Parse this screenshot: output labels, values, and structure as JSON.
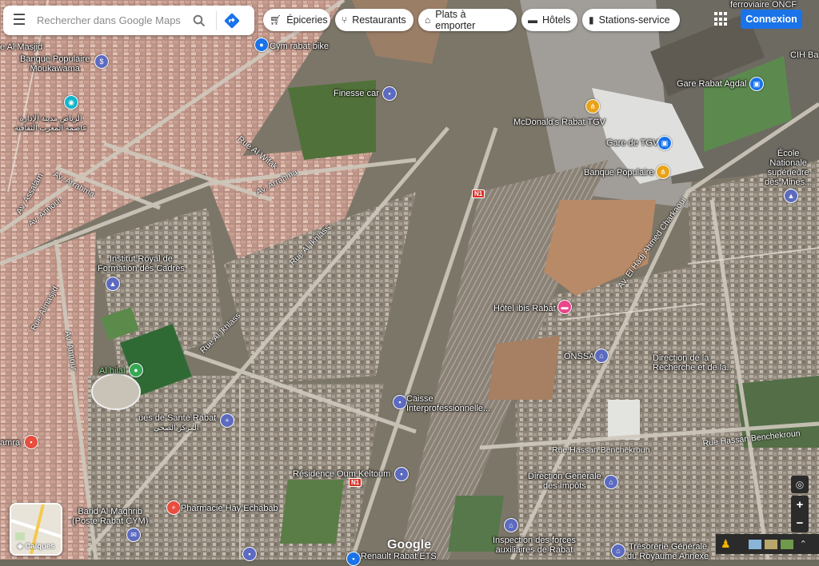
{
  "search": {
    "placeholder": "Rechercher dans Google Maps"
  },
  "chips": [
    {
      "label": "Épiceries",
      "icon": "cart-icon"
    },
    {
      "label": "Restaurants",
      "icon": "fork-knife-icon"
    },
    {
      "label": "Plats à emporter",
      "icon": "takeout-icon"
    },
    {
      "label": "Hôtels",
      "icon": "bed-icon"
    },
    {
      "label": "Stations-service",
      "icon": "fuel-icon"
    }
  ],
  "login": "Connexion",
  "layers": "Calques",
  "brand": "Google",
  "zoom": {
    "in": "+",
    "out": "−"
  },
  "places": {
    "al_masjid": "e Al Masjid",
    "banque_pop_moukawama": "Banque Populaire\nMoukawama",
    "cym": "Cym rabat bike",
    "finesse": "Finesse car",
    "arabic1": "الرياض مدينة الإدارة\nعاصمة المغرب الثقافية",
    "mcdo": "McDonald's Rabat TGV",
    "gare_tgv": "Gare de TGV",
    "banque_pop": "Banque Populaire",
    "gare_agdal": "Gare Rabat Agdal",
    "oncf": "ferroviaire ONCF",
    "cih": "CIH Ba",
    "ecole": "École\nNationale\nsupérieure\ndes Mines...",
    "institut": "Institut Royal de\nFormation des Cadres",
    "al_hilal": "Al hilal",
    "ibis": "Hôtel ibis Rabat",
    "onssa": "ONSSA",
    "direction_rech": "Direction de la\nRecherche et de la...",
    "caisse": "Caisse\nInterprofessionnelle...",
    "sante": "ues de Santé Rabat",
    "sante_ar": "المركز الصحي",
    "amra": "amra",
    "residence": "Résidence Oum Keltoum",
    "direction_impots": "Direction Générale\ndes Impôts",
    "barid": "Barid Al Maghrib\n(Poste Rabat CYM)",
    "pharmacie": "Pharmacie Hay Echabab",
    "inspection": "Inspection des forces\nauxiliaires de Rabat",
    "tresorerie": "Trésorerie Générale\ndu Royaume Annexe",
    "renault": "Renault Rabat ETS"
  },
  "roads": {
    "al_wifak": "Rue Al Wifak",
    "arrahma1": "Av. Arrahma",
    "arrahma2": "Av. Arrahma",
    "assalam": "Av. Assalam",
    "annour1": "Av. Annour",
    "annour2": "Av. Annour",
    "almasjid": "Rue Almasjid",
    "al_ikhlass1": "Rue Al Ikhlass",
    "al_ikhlass2": "Rue Al Ikhlass",
    "chakoui": "Av. El Hadj Ahmed Charkaoui",
    "hassan1": "Rue Hassan Benchekroun",
    "hassan2": "Rue Hassan Benchekroun",
    "n1a": "N1",
    "n1b": "N1"
  }
}
